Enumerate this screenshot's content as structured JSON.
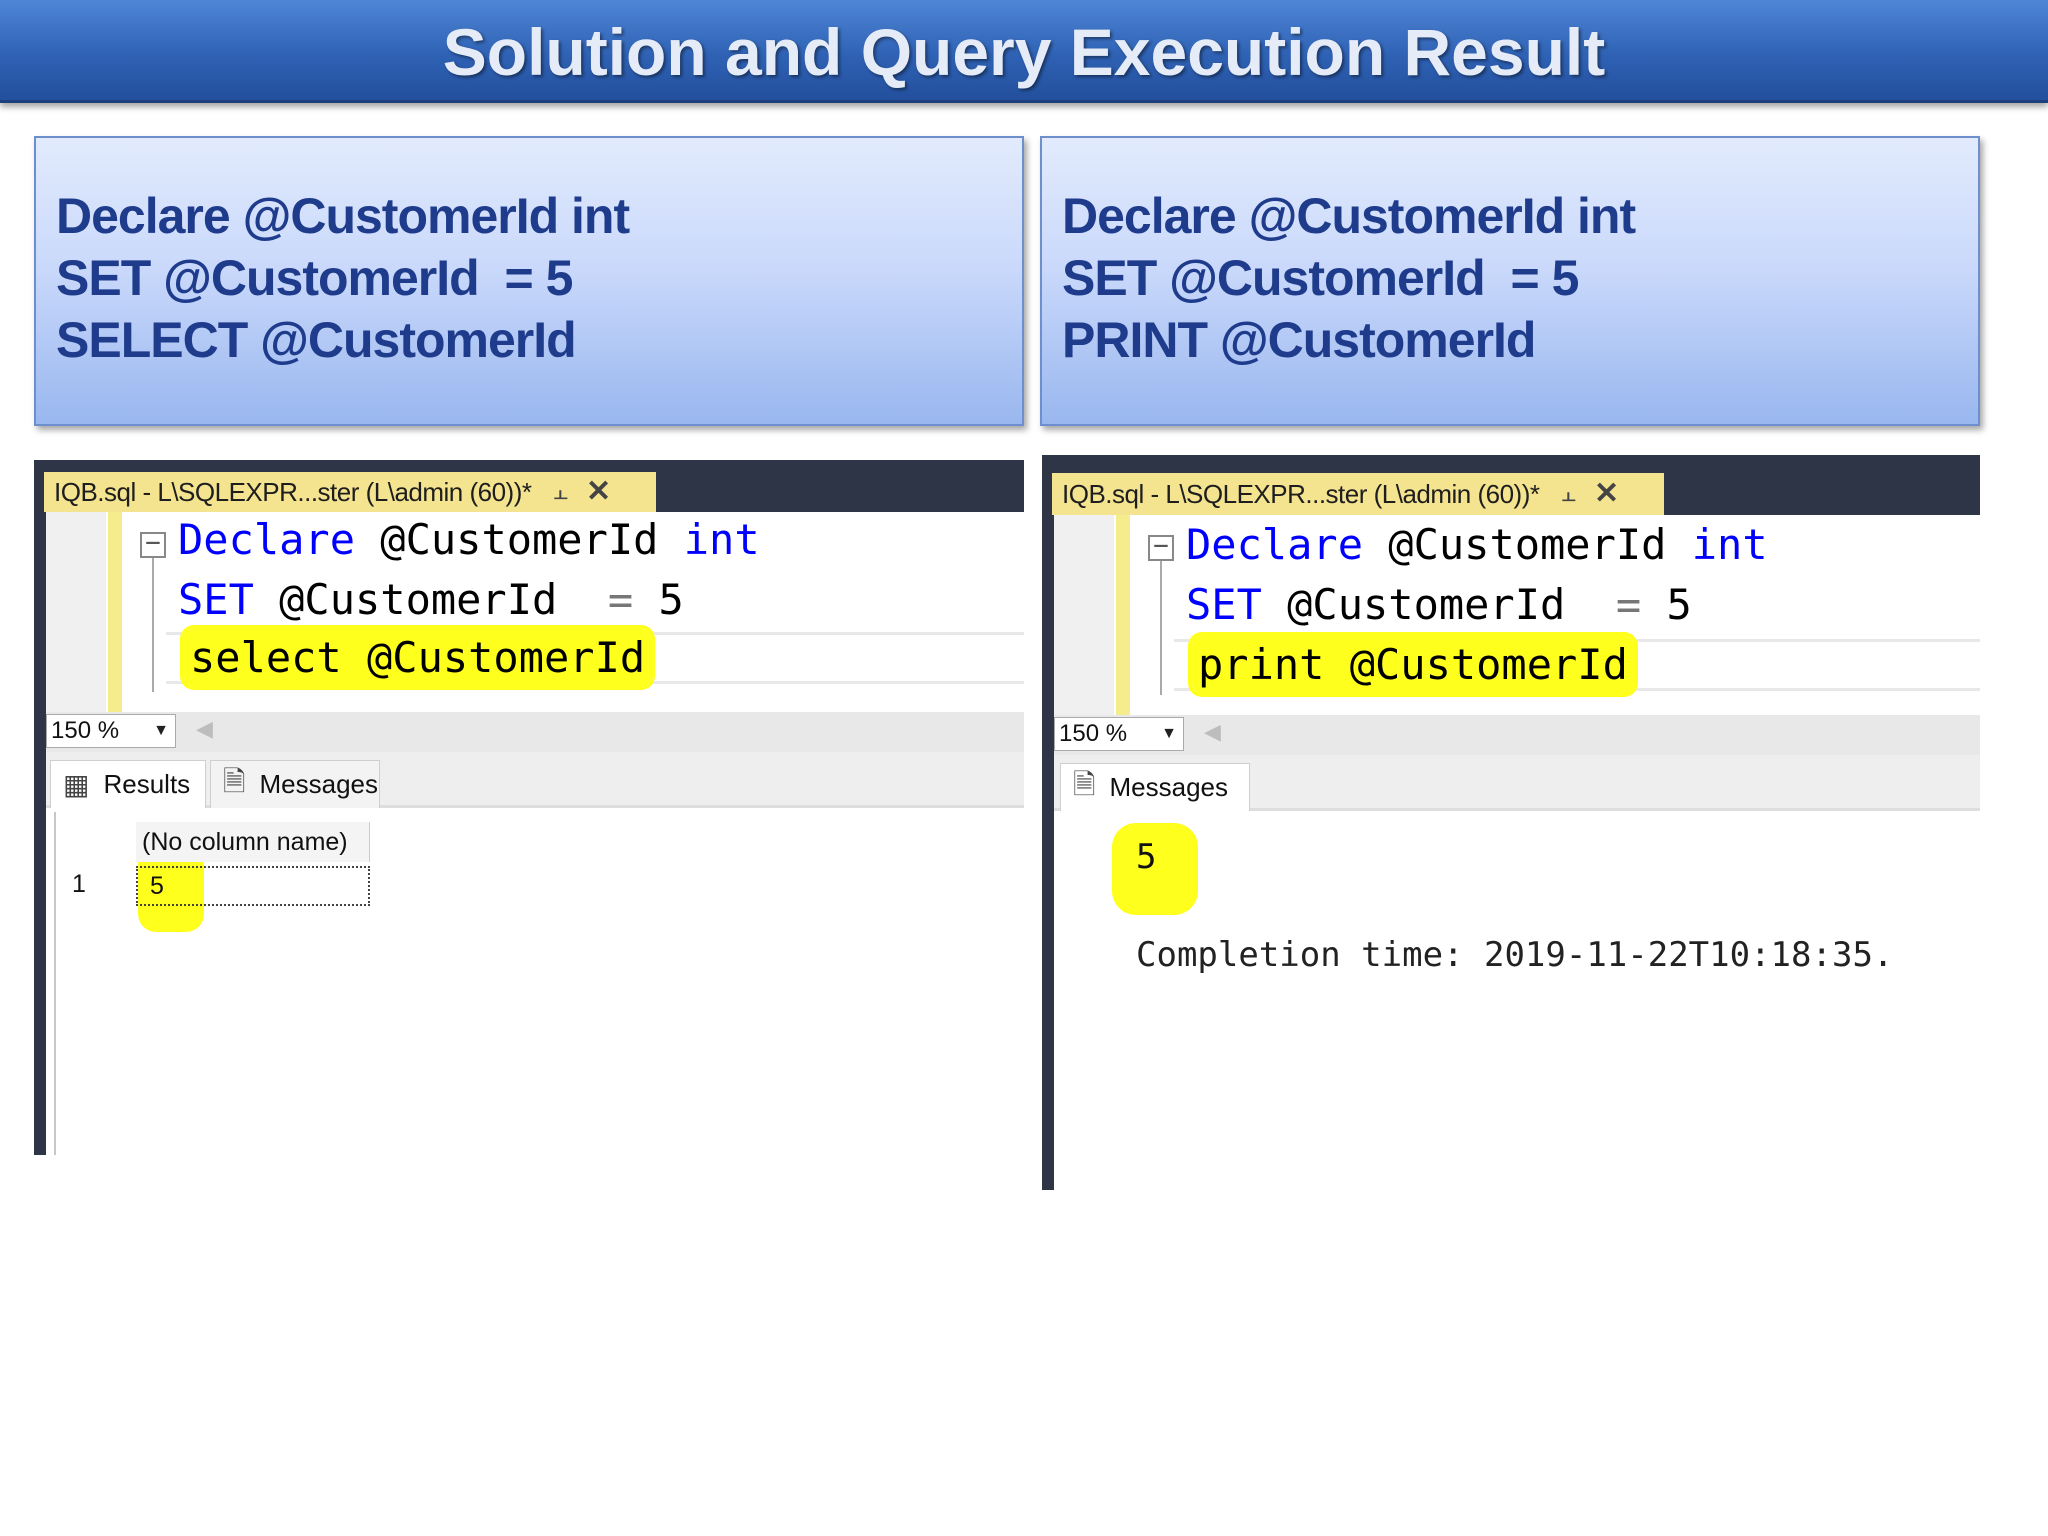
{
  "title": "Solution and Query Execution Result",
  "left_box": {
    "lines": [
      "Declare @CustomerId int",
      "SET @CustomerId  = 5",
      "SELECT @CustomerId"
    ]
  },
  "right_box": {
    "lines": [
      "Declare @CustomerId int",
      "SET @CustomerId  = 5",
      "PRINT @CustomerId"
    ]
  },
  "left_ssms": {
    "tab_title": "IQB.sql - L\\SQLEXPR...ster (L\\admin (60))*",
    "code": {
      "line1_kw": "Declare",
      "line1_var": " @CustomerId ",
      "line1_type": "int",
      "line2_kw": "SET",
      "line2_var": " @CustomerId  ",
      "line2_op": "=",
      "line2_val": " 5",
      "line3": "select @CustomerId"
    },
    "zoom": "150 %",
    "tabs": {
      "results": "Results",
      "messages": "Messages"
    },
    "grid": {
      "column_header": "(No column name)",
      "row_number": "1",
      "value": "5"
    }
  },
  "right_ssms": {
    "tab_title": "IQB.sql - L\\SQLEXPR...ster (L\\admin (60))*",
    "code": {
      "line1_kw": "Declare",
      "line1_var": " @CustomerId ",
      "line1_type": "int",
      "line2_kw": "SET",
      "line2_var": " @CustomerId  ",
      "line2_op": "=",
      "line2_val": " 5",
      "line3": "print @CustomerId"
    },
    "zoom": "150 %",
    "tabs": {
      "messages": "Messages"
    },
    "message_value": "5",
    "completion": "Completion time: 2019-11-22T10:18:35."
  },
  "colors": {
    "banner": "#2f62b5",
    "code_box_text": "#1f3c8c",
    "highlight": "#ffff1e",
    "keyword": "#0000ff",
    "ide_dark": "#2d3547",
    "doc_tab": "#f4e38f"
  },
  "icons": [
    "pin-icon",
    "close-icon",
    "collapse-icon",
    "dropdown-arrow-icon",
    "scroll-left-icon",
    "grid-icon",
    "messages-icon"
  ]
}
